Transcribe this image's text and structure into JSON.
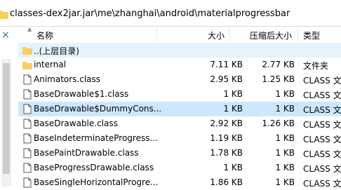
{
  "address": {
    "path": "classes-dex2jar.jar\\me\\zhanghai\\android\\materialprogressbar"
  },
  "columns": {
    "name": "名称",
    "size": "大小",
    "compressed": "压缩后大小",
    "type": "类型"
  },
  "rows": [
    {
      "name": "..(上层目录)",
      "size": "",
      "compressed": "",
      "type": "",
      "kind": "folder"
    },
    {
      "name": "internal",
      "size": "7.11 KB",
      "compressed": "2.77 KB",
      "type": "文件夹",
      "kind": "folder"
    },
    {
      "name": "Animators.class",
      "size": "2.95 KB",
      "compressed": "1.25 KB",
      "type": "CLASS 文件",
      "kind": "file"
    },
    {
      "name": "BaseDrawable$1.class",
      "size": "1 KB",
      "compressed": "1 KB",
      "type": "CLASS 文件",
      "kind": "file"
    },
    {
      "name": "BaseDrawable$DummyCons...",
      "size": "1 KB",
      "compressed": "1 KB",
      "type": "CLASS 文件",
      "kind": "file"
    },
    {
      "name": "BaseDrawable.class",
      "size": "2.92 KB",
      "compressed": "1.26 KB",
      "type": "CLASS 文件",
      "kind": "file"
    },
    {
      "name": "BaseIndeterminateProgress...",
      "size": "1.19 KB",
      "compressed": "1 KB",
      "type": "CLASS 文件",
      "kind": "file"
    },
    {
      "name": "BasePaintDrawable.class",
      "size": "1.78 KB",
      "compressed": "1 KB",
      "type": "CLASS 文件",
      "kind": "file"
    },
    {
      "name": "BaseProgressDrawable.class",
      "size": "1 KB",
      "compressed": "1 KB",
      "type": "CLASS 文件",
      "kind": "file"
    },
    {
      "name": "BaseSingleHorizontalProgre...",
      "size": "1.86 KB",
      "compressed": "1 KB",
      "type": "CLASS 文件",
      "kind": "file"
    }
  ],
  "left_panel": {
    "close_glyph": "×"
  },
  "colors": {
    "folder": "#f7cf5e",
    "hover_row": "#e5f3ff",
    "selected_row": "#cce8ff"
  }
}
